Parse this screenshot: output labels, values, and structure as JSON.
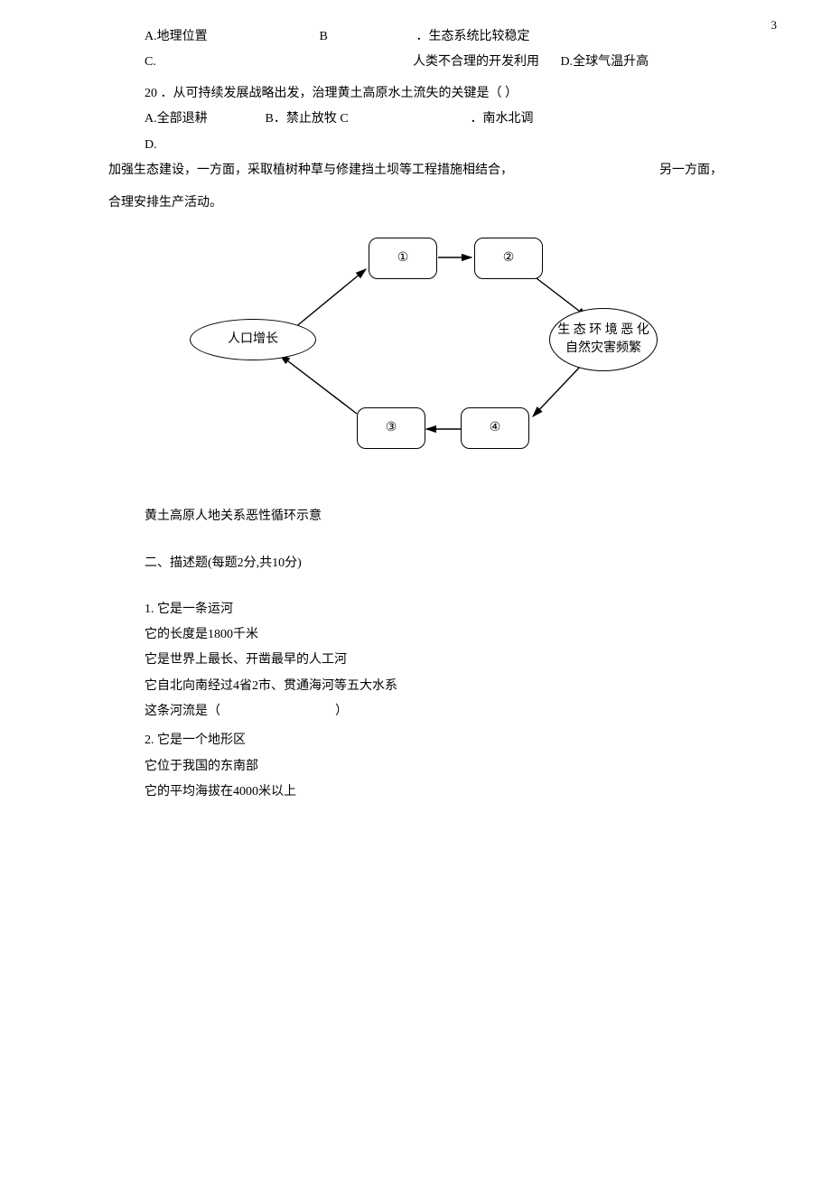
{
  "page_number": "3",
  "opt19": {
    "a": "A.地理位置",
    "b_label": "B",
    "b_text": "．生态系统比较稳定",
    "c_label": "C.",
    "c_text": "人类不合理的开发利用",
    "d": "D.全球气温升高"
  },
  "q20": {
    "stem": "20 ．从可持续发展战略出发，治理黄土高原水土流失的关键是（ ）",
    "a": "A.全部退耕",
    "b": "B．禁止放牧 C",
    "c_text": "．南水北调",
    "d_label": "D.",
    "d_text_line1": "加强生态建设，一方面，采取植树种草与修建挡土坝等工程措施相结合，",
    "d_text_line1_right": "另一方面，",
    "d_text_line2": "合理安排生产活动。"
  },
  "chart_data": {
    "type": "diagram",
    "nodes": {
      "box1": "①",
      "box2": "②",
      "box3": "③",
      "box4": "④",
      "left_ellipse": "人口增长",
      "right_ellipse_line1": "生 态 环 境 恶 化",
      "right_ellipse_line2": "自然灾害频繁"
    },
    "caption": "黄土高原人地关系恶性循环示意"
  },
  "section2": {
    "title": "二、描述题(每题2分,共10分)",
    "q1": {
      "lead": "1.  它是一条运河",
      "l2": "它的长度是1800千米",
      "l3": "它是世界上最长、开凿最早的人工河",
      "l4": "它自北向南经过4省2市、贯通海河等五大水系",
      "l5_left": "这条河流是（",
      "l5_right": "）"
    },
    "q2": {
      "lead": "2.  它是一个地形区",
      "l2": "它位于我国的东南部",
      "l3": "它的平均海拔在4000米以上"
    }
  }
}
